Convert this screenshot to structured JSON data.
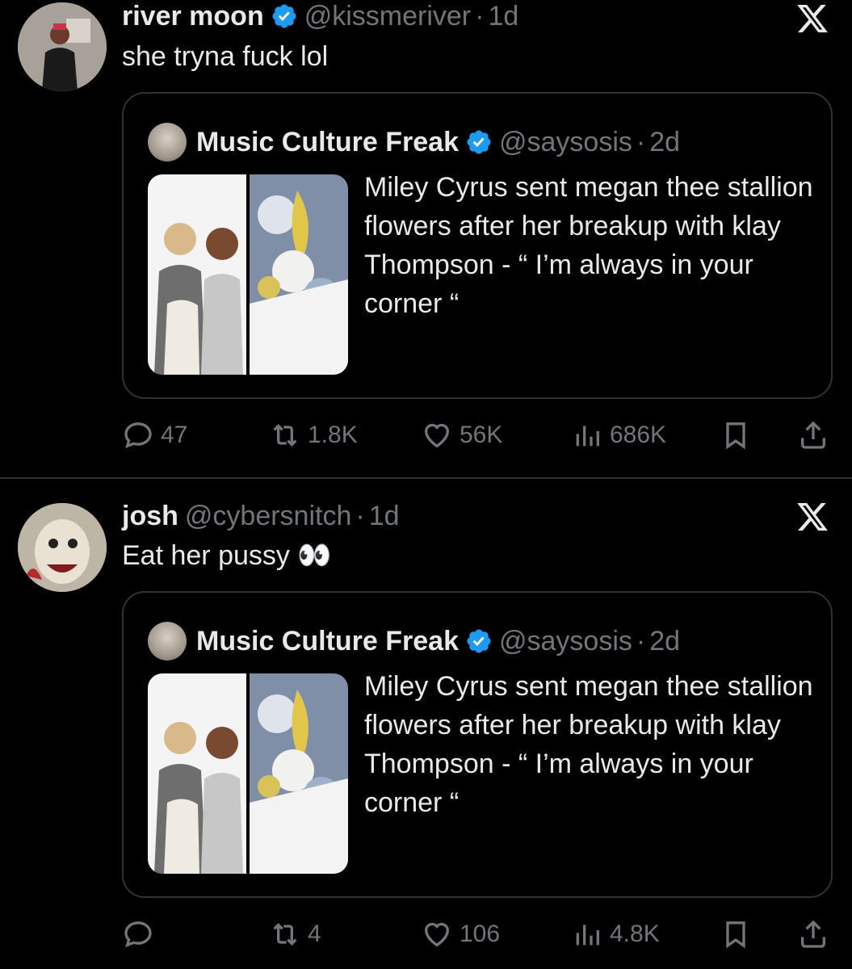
{
  "tweets": [
    {
      "name": "river moon",
      "handle": "@kissmeriver",
      "separator": "·",
      "time": "1d",
      "text": "she tryna fuck lol",
      "quote": {
        "name": "Music Culture Freak",
        "handle": "@saysosis",
        "separator": "·",
        "time": "2d",
        "text": "Miley Cyrus sent megan thee stallion flowers after her breakup with klay Thompson - “ I’m always in your corner “"
      },
      "stats": {
        "replies": "47",
        "reposts": "1.8K",
        "likes": "56K",
        "views": "686K"
      }
    },
    {
      "name": "josh",
      "handle": "@cybersnitch",
      "separator": "·",
      "time": "1d",
      "text": "Eat her pussy 👀",
      "quote": {
        "name": "Music Culture Freak",
        "handle": "@saysosis",
        "separator": "·",
        "time": "2d",
        "text": "Miley Cyrus sent megan thee stallion flowers after her breakup with klay Thompson - “ I’m always in your corner “"
      },
      "stats": {
        "replies": "",
        "reposts": "4",
        "likes": "106",
        "views": "4.8K"
      }
    }
  ],
  "icons": {
    "verified": "verified-badge-icon",
    "platform": "x-logo-icon",
    "reply": "reply-icon",
    "repost": "repost-icon",
    "like": "heart-icon",
    "views": "views-icon",
    "bookmark": "bookmark-icon",
    "share": "share-icon"
  },
  "colors": {
    "background": "#000000",
    "text": "#e7e9ea",
    "muted": "#71767b",
    "verified": "#1d9bf0",
    "border": "#2f3336"
  }
}
